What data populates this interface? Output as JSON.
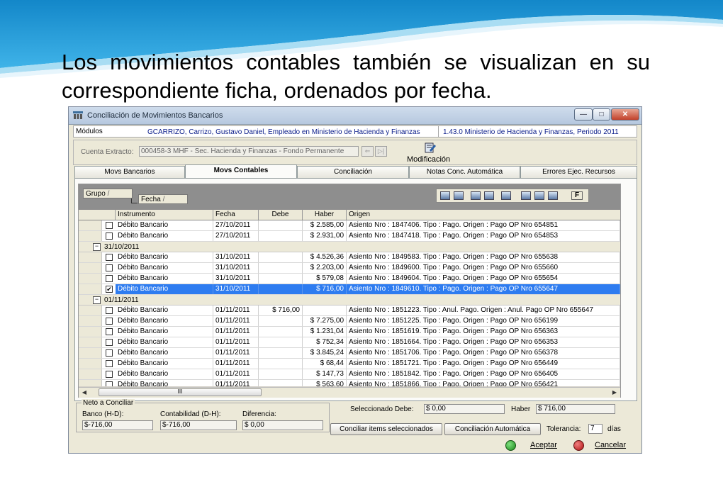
{
  "slide": {
    "text": "Los movimientos contables también se visualizan en su correspondiente ficha, ordenados por fecha."
  },
  "window": {
    "title": "Conciliación de Movimientos Bancarios",
    "minimize": "—",
    "maximize": "□",
    "close": "✕",
    "modulos_label": "Módulos",
    "user_info": "GCARRIZO, Carrizo, Gustavo Daniel, Empleado en Ministerio de Hacienda y Finanzas",
    "version_info": "1.43.0 Ministerio de Hacienda y Finanzas, Periodo 2011",
    "cuenta_label": "Cuenta Extracto:",
    "cuenta_value": "000458-3 MHF - Sec. Hacienda y Finanzas - Fondo Permanente",
    "modificacion_label": "Modificación"
  },
  "tabs": [
    "Movs Bancarios",
    "Movs Contables",
    "Conciliación",
    "Notas Conc. Automática",
    "Errores Ejec. Recursos"
  ],
  "group_area": {
    "chip1": "Grupo",
    "chip2": "Fecha",
    "sort_glyph": "/"
  },
  "columns": [
    "Instrumento",
    "Fecha",
    "Debe",
    "Haber",
    "Origen"
  ],
  "rows": [
    {
      "type": "item",
      "checked": false,
      "instrumento": "Débito Bancario",
      "fecha": "27/10/2011",
      "debe": "",
      "haber": "$ 2.585,00",
      "origen": "Asiento Nro : 1847406. Tipo : Pago. Origen : Pago OP Nro  654851"
    },
    {
      "type": "item",
      "checked": false,
      "instrumento": "Débito Bancario",
      "fecha": "27/10/2011",
      "debe": "",
      "haber": "$ 2.931,00",
      "origen": "Asiento Nro : 1847418. Tipo : Pago. Origen : Pago OP Nro  654853"
    },
    {
      "type": "group",
      "label": "31/10/2011"
    },
    {
      "type": "item",
      "checked": false,
      "instrumento": "Débito Bancario",
      "fecha": "31/10/2011",
      "debe": "",
      "haber": "$ 4.526,36",
      "origen": "Asiento Nro : 1849583. Tipo : Pago. Origen : Pago OP Nro  655638"
    },
    {
      "type": "item",
      "checked": false,
      "instrumento": "Débito Bancario",
      "fecha": "31/10/2011",
      "debe": "",
      "haber": "$ 2.203,00",
      "origen": "Asiento Nro : 1849600. Tipo : Pago. Origen : Pago OP Nro  655660"
    },
    {
      "type": "item",
      "checked": false,
      "instrumento": "Débito Bancario",
      "fecha": "31/10/2011",
      "debe": "",
      "haber": "$ 579,08",
      "origen": "Asiento Nro : 1849604. Tipo : Pago. Origen : Pago OP Nro  655654"
    },
    {
      "type": "item",
      "checked": true,
      "selected": true,
      "instrumento": "Débito Bancario",
      "fecha": "31/10/2011",
      "debe": "",
      "haber": "$ 716,00",
      "origen": "Asiento Nro : 1849610. Tipo : Pago. Origen : Pago OP Nro  655647"
    },
    {
      "type": "group",
      "label": "01/11/2011"
    },
    {
      "type": "item",
      "checked": false,
      "instrumento": "Débito Bancario",
      "fecha": "01/11/2011",
      "debe": "$ 716,00",
      "haber": "",
      "origen": "Asiento Nro : 1851223. Tipo : Anul. Pago. Origen : Anul. Pago OP Nro  655647"
    },
    {
      "type": "item",
      "checked": false,
      "instrumento": "Débito Bancario",
      "fecha": "01/11/2011",
      "debe": "",
      "haber": "$ 7.275,00",
      "origen": "Asiento Nro : 1851225. Tipo : Pago. Origen : Pago OP Nro  656199"
    },
    {
      "type": "item",
      "checked": false,
      "instrumento": "Débito Bancario",
      "fecha": "01/11/2011",
      "debe": "",
      "haber": "$ 1.231,04",
      "origen": "Asiento Nro : 1851619. Tipo : Pago. Origen : Pago OP Nro  656363"
    },
    {
      "type": "item",
      "checked": false,
      "instrumento": "Débito Bancario",
      "fecha": "01/11/2011",
      "debe": "",
      "haber": "$ 752,34",
      "origen": "Asiento Nro : 1851664. Tipo : Pago. Origen : Pago OP Nro  656353"
    },
    {
      "type": "item",
      "checked": false,
      "instrumento": "Débito Bancario",
      "fecha": "01/11/2011",
      "debe": "",
      "haber": "$ 3.845,24",
      "origen": "Asiento Nro : 1851706. Tipo : Pago. Origen : Pago OP Nro  656378"
    },
    {
      "type": "item",
      "checked": false,
      "instrumento": "Débito Bancario",
      "fecha": "01/11/2011",
      "debe": "",
      "haber": "$ 68,44",
      "origen": "Asiento Nro : 1851721. Tipo : Pago. Origen : Pago OP Nro  656449"
    },
    {
      "type": "item",
      "checked": false,
      "instrumento": "Débito Bancario",
      "fecha": "01/11/2011",
      "debe": "",
      "haber": "$ 147,73",
      "origen": "Asiento Nro : 1851842. Tipo : Pago. Origen : Pago OP Nro  656405"
    },
    {
      "type": "item",
      "checked": false,
      "instrumento": "Débito Bancario",
      "fecha": "01/11/2011",
      "debe": "",
      "haber": "$ 563,60",
      "origen": "Asiento Nro : 1851866. Tipo : Pago. Origen : Pago OP Nro  656421"
    }
  ],
  "scroll": {
    "thumb_grip": "III"
  },
  "bottom": {
    "neto_title": "Neto a Conciliar",
    "banco_label": "Banco (H-D):",
    "banco_value": "$-716,00",
    "contab_label": "Contabilidad (D-H):",
    "contab_value": "$-716,00",
    "dif_label": "Diferencia:",
    "dif_value": "$ 0,00",
    "sel_debe_label": "Seleccionado Debe:",
    "sel_debe_value": "$ 0,00",
    "haber_label": "Haber",
    "haber_value": "$ 716,00",
    "btn_conciliar": "Conciliar items seleccionados",
    "btn_auto": "Conciliación Automática",
    "tol_label": "Tolerancia:",
    "tol_value": "7",
    "dias_label": "días",
    "aceptar": "Aceptar",
    "cancelar": "Cancelar"
  },
  "colors": {
    "selected_row": "#2e7cf0",
    "link_blue": "#0b1d8a",
    "ok_green": "#2aa52a",
    "cancel_red": "#cc2020"
  }
}
